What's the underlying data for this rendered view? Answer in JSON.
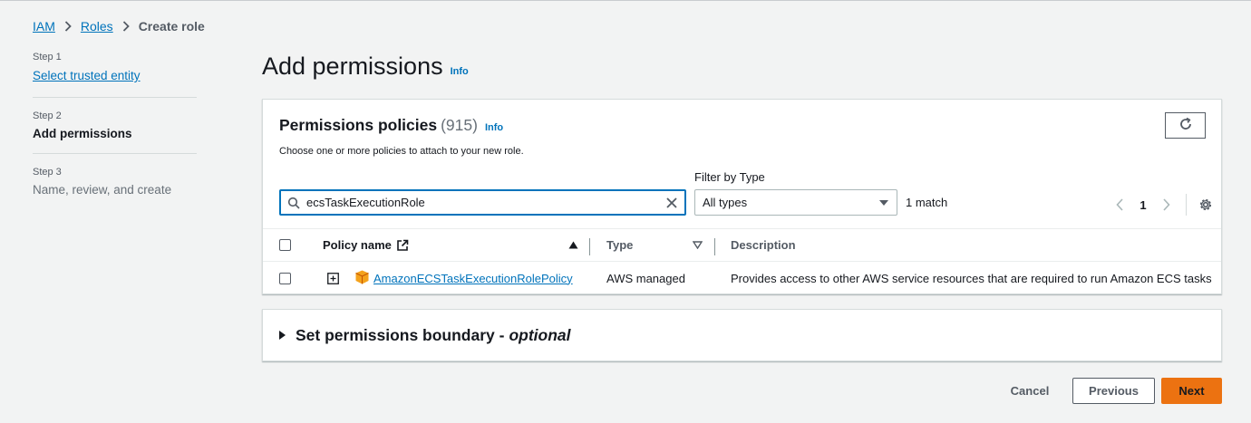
{
  "breadcrumb": {
    "items": [
      {
        "label": "IAM"
      },
      {
        "label": "Roles"
      }
    ],
    "current": "Create role"
  },
  "steps": [
    {
      "num": "Step 1",
      "title": "Select trusted entity",
      "state": "link"
    },
    {
      "num": "Step 2",
      "title": "Add permissions",
      "state": "active"
    },
    {
      "num": "Step 3",
      "title": "Name, review, and create",
      "state": "disabled"
    }
  ],
  "page": {
    "title": "Add permissions",
    "info": "Info"
  },
  "policies": {
    "title": "Permissions policies",
    "count": "(915)",
    "info": "Info",
    "description": "Choose one or more policies to attach to your new role.",
    "search_value": "ecsTaskExecutionRole",
    "filter_label": "Filter by Type",
    "filter_value": "All types",
    "match_count": "1 match",
    "page": "1",
    "columns": {
      "policy_name": "Policy name",
      "type": "Type",
      "description": "Description"
    },
    "rows": [
      {
        "name": "AmazonECSTaskExecutionRolePolicy",
        "type": "AWS managed",
        "description": "Provides access to other AWS service resources that are required to run Amazon ECS tasks"
      }
    ]
  },
  "boundary": {
    "title": "Set permissions boundary -",
    "optional": "optional"
  },
  "footer": {
    "cancel": "Cancel",
    "previous": "Previous",
    "next": "Next"
  },
  "colors": {
    "link": "#0073bb",
    "primary_button": "#ec7211",
    "policy_icon": "#f4a21c"
  }
}
